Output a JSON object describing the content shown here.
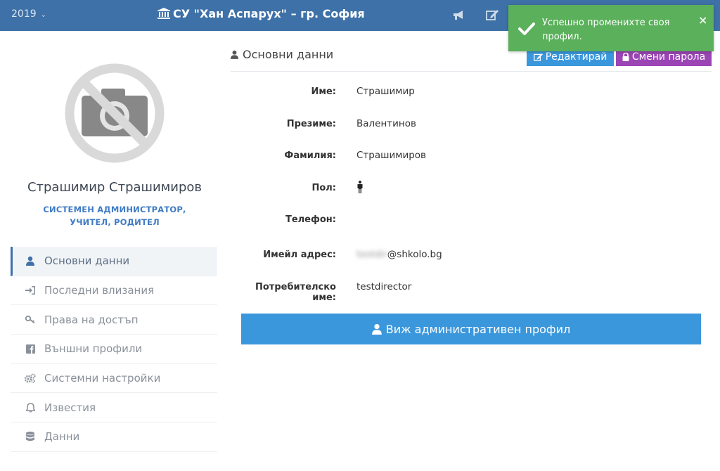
{
  "header": {
    "year": "2019",
    "school_name": "СУ \"Хан Аспарух\" – гр. София"
  },
  "icons": {
    "year_chevron": "chevron-down-icon",
    "school": "bank-icon",
    "announcements": "bullhorn-icon",
    "edit_top": "edit-icon"
  },
  "notification": {
    "message": "Успешно променихте своя профил.",
    "close": "×"
  },
  "profile": {
    "name": "Страшимир Страшимиров",
    "roles": "СИСТЕМЕН АДМИНИСТРАТОР, УЧИТЕЛ, РОДИТЕЛ"
  },
  "menu": {
    "items": [
      {
        "label": "Основни данни",
        "icon": "user-icon"
      },
      {
        "label": "Последни влизания",
        "icon": "sign-in-icon"
      },
      {
        "label": "Права на достъп",
        "icon": "key-icon"
      },
      {
        "label": "Външни профили",
        "icon": "facebook-icon"
      },
      {
        "label": "Системни настройки",
        "icon": "gears-icon"
      },
      {
        "label": "Известия",
        "icon": "bell-icon"
      },
      {
        "label": "Данни",
        "icon": "database-icon"
      }
    ]
  },
  "main": {
    "title": "Основни данни",
    "edit_button": "Редактирай",
    "password_button": "Смени парола",
    "fields": {
      "first_name": {
        "label": "Име:",
        "value": "Страшимир"
      },
      "middle_name": {
        "label": "Презиме:",
        "value": "Валентинов"
      },
      "last_name": {
        "label": "Фамилия:",
        "value": "Страшимиров"
      },
      "gender": {
        "label": "Пол:"
      },
      "phone": {
        "label": "Телефон:",
        "value": ""
      },
      "email": {
        "label": "Имейл адрес:",
        "value_hidden": "testdir",
        "value_domain": "@shkolo.bg"
      },
      "username": {
        "label": "Потребителско име:",
        "value": "testdirector"
      }
    },
    "admin_button": "Виж административен профил"
  },
  "colors": {
    "header_bg": "#3e71a7",
    "primary_button": "#3b97dc",
    "password_button": "#9b45b5",
    "toast_bg": "#5bb05b",
    "role_text": "#3f7bc4"
  }
}
